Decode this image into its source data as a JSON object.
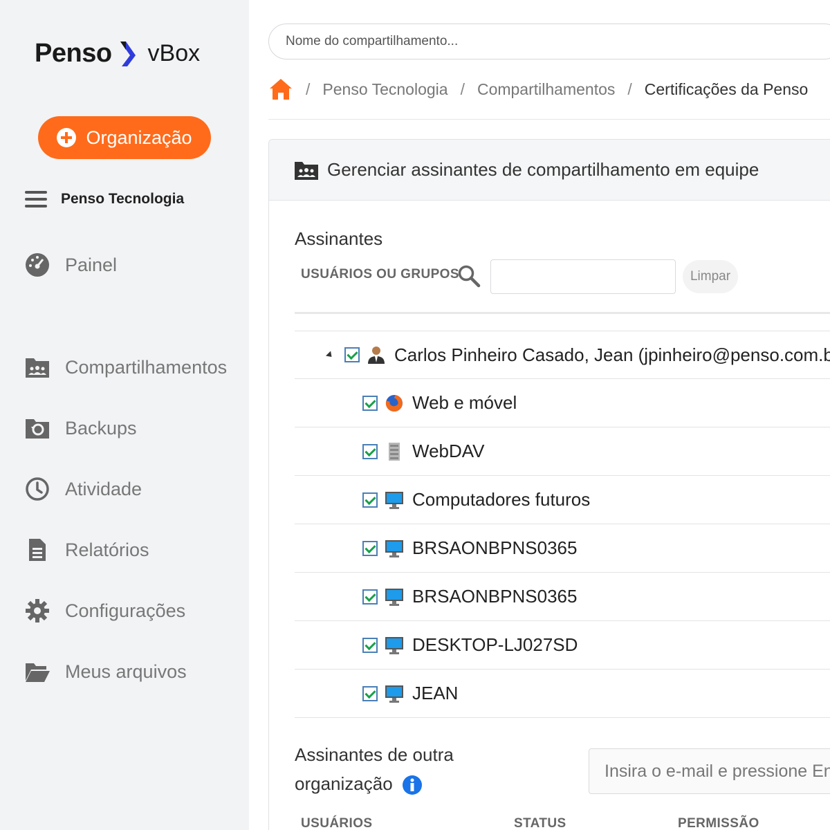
{
  "sidebar": {
    "logo_penso": "Penso",
    "logo_product": "vBox",
    "org_button": "Organização",
    "tenant": "Penso Tecnologia",
    "nav": [
      {
        "label": "Painel",
        "icon": "dashboard-icon"
      },
      {
        "label": "Compartilhamentos",
        "icon": "shared-folder-icon"
      },
      {
        "label": "Backups",
        "icon": "backup-icon"
      },
      {
        "label": "Atividade",
        "icon": "clock-icon"
      },
      {
        "label": "Relatórios",
        "icon": "report-icon"
      },
      {
        "label": "Configurações",
        "icon": "gear-icon"
      },
      {
        "label": "Meus arquivos",
        "icon": "open-folder-icon"
      }
    ]
  },
  "search": {
    "placeholder": "Nome do compartilhamento..."
  },
  "breadcrumb": {
    "items": [
      "Penso Tecnologia",
      "Compartilhamentos"
    ],
    "current": "Certificações da Penso",
    "separator": "/"
  },
  "panel": {
    "title": "Gerenciar assinantes de compartilhamento em equipe",
    "subscribers_title": "Assinantes",
    "filter_label": "USUÁRIOS OU GRUPOS",
    "filter_value": "",
    "clear_button": "Limpar",
    "tree": {
      "user": "Carlos Pinheiro Casado, Jean (jpinheiro@penso.com.br)",
      "children": [
        {
          "label": "Web e móvel",
          "icon": "firefox-icon"
        },
        {
          "label": "WebDAV",
          "icon": "server-icon"
        },
        {
          "label": "Computadores futuros",
          "icon": "monitor-icon"
        },
        {
          "label": "BRSAONBPNS0365",
          "icon": "monitor-icon"
        },
        {
          "label": "BRSAONBPNS0365",
          "icon": "monitor-icon"
        },
        {
          "label": "DESKTOP-LJ027SD",
          "icon": "monitor-icon"
        },
        {
          "label": "JEAN",
          "icon": "monitor-icon"
        }
      ]
    },
    "other_org_title": "Assinantes de outra organização",
    "email_placeholder": "Insira o e-mail e pressione Enter",
    "columns": [
      "USUÁRIOS",
      "STATUS",
      "PERMISSÃO"
    ]
  },
  "colors": {
    "accent": "#ff6b1a",
    "logo_blue": "#2f3cdb",
    "info_blue": "#1a73e8"
  }
}
